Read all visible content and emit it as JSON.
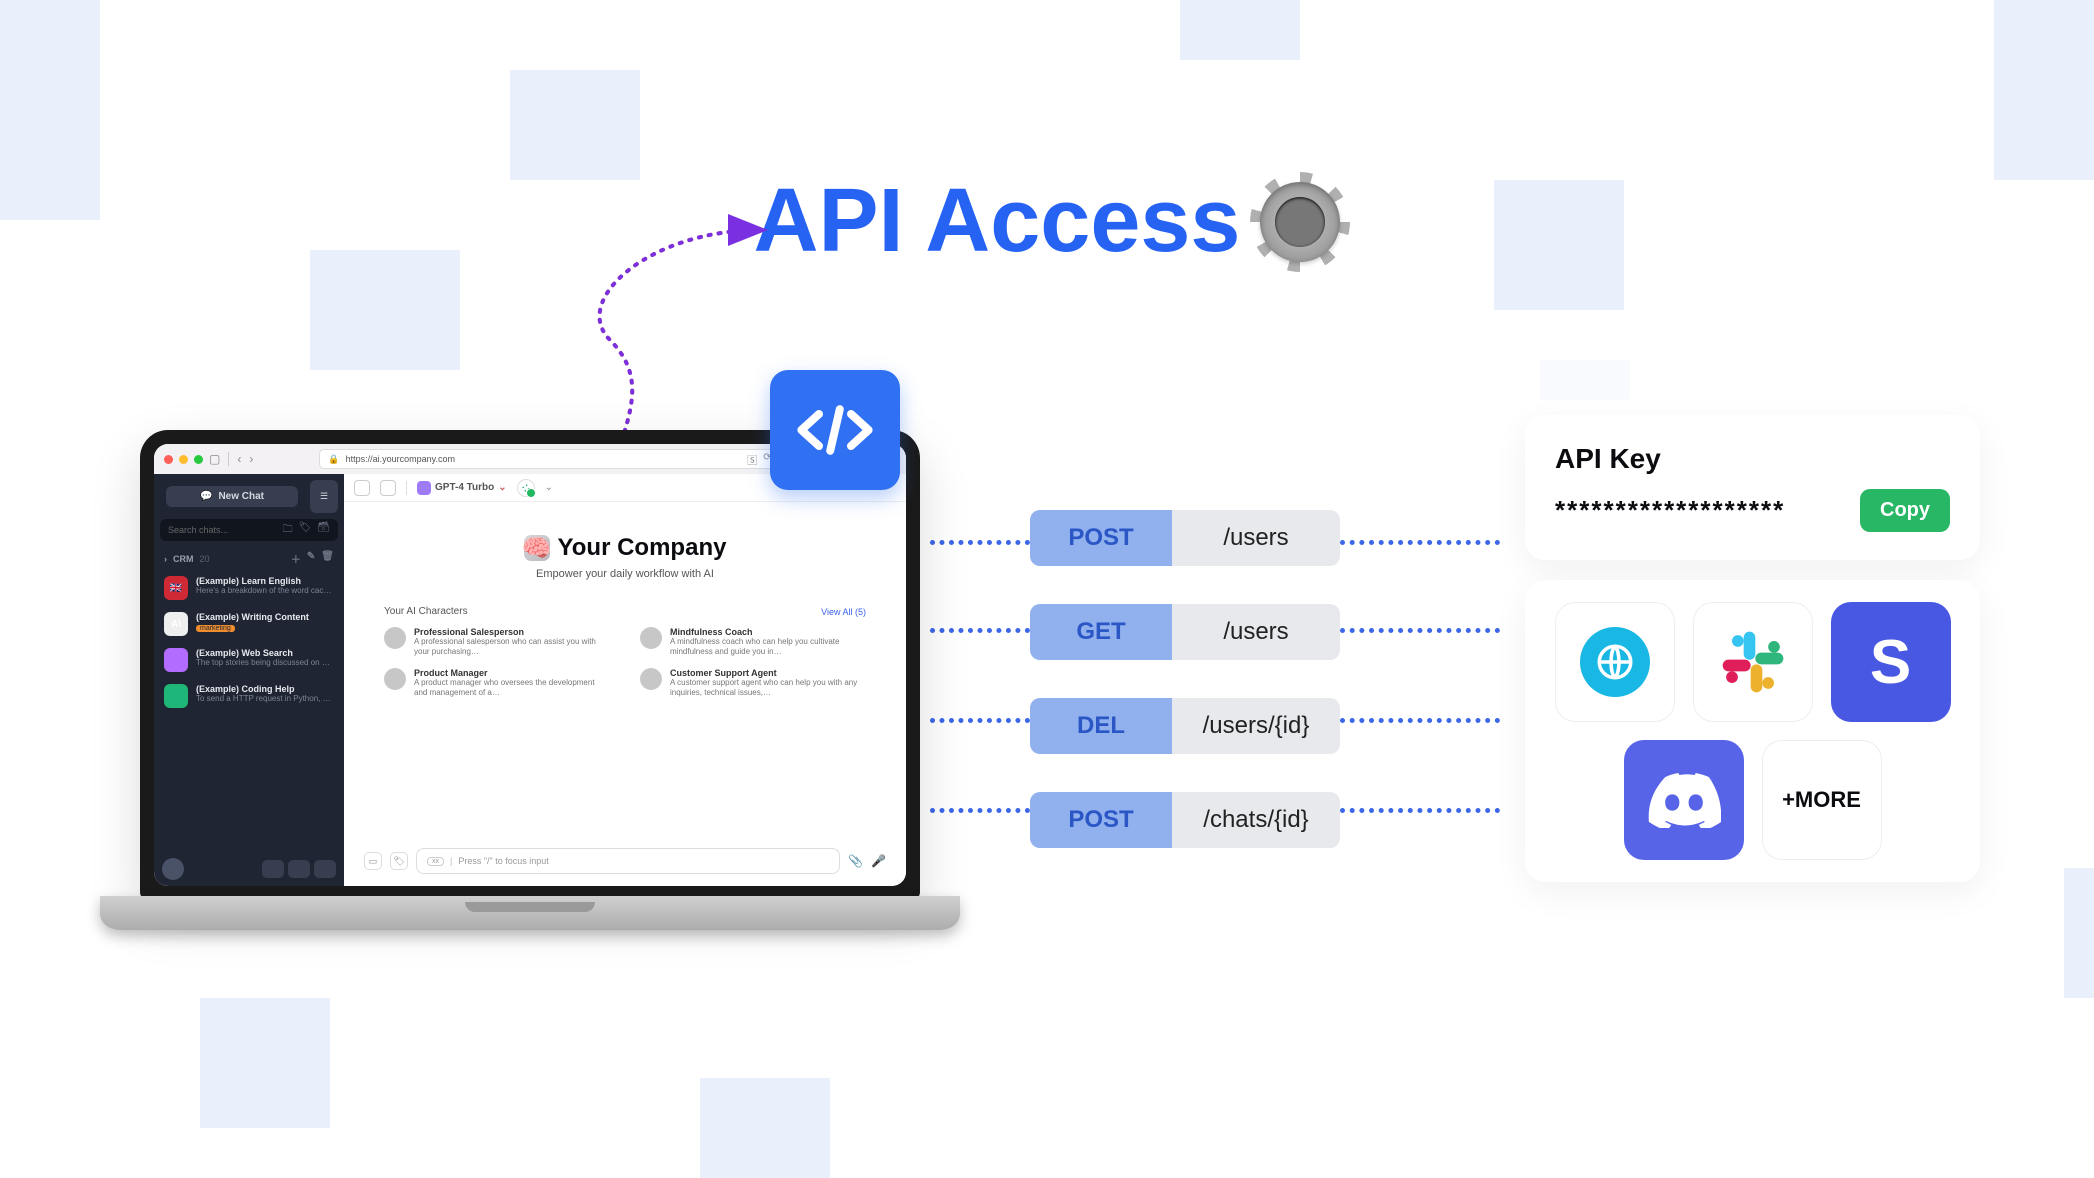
{
  "headline": "API Access",
  "browser": {
    "url": "https://ai.yourcompany.com"
  },
  "sidebar": {
    "new_chat": "New Chat",
    "search_placeholder": "Search chats...",
    "folder": {
      "name": "CRM",
      "count": "20"
    },
    "chats": [
      {
        "title": "(Example) Learn English",
        "sub": "Here's a breakdown of the word cac…",
        "thumb_bg": "#cf2a34",
        "thumb_text": "🇬🇧"
      },
      {
        "title": "(Example) Writing Content",
        "sub": "",
        "tag": "marketing",
        "thumb_bg": "#efefef",
        "thumb_text": "A\\"
      },
      {
        "title": "(Example) Web Search",
        "sub": "The top stories being discussed on H…",
        "thumb_bg": "#b26cff",
        "thumb_text": ""
      },
      {
        "title": "(Example) Coding Help",
        "sub": "To send a HTTP request in Python, y…",
        "thumb_bg": "#1fb779",
        "thumb_text": ""
      }
    ]
  },
  "topbar": {
    "model": "GPT-4 Turbo"
  },
  "hero": {
    "title": "Your Company",
    "subtitle": "Empower your daily workflow with AI"
  },
  "characters": {
    "heading": "Your AI Characters",
    "view_all": "View All (5)",
    "items": [
      {
        "name": "Professional Salesperson",
        "desc": "A professional salesperson who can assist you with your purchasing…"
      },
      {
        "name": "Mindfulness Coach",
        "desc": "A mindfulness coach who can help you cultivate mindfulness and guide you in…"
      },
      {
        "name": "Product Manager",
        "desc": "A product manager who oversees the development and management of a…"
      },
      {
        "name": "Customer Support Agent",
        "desc": "A customer support agent who can help you with any inquiries, technical issues,…"
      }
    ]
  },
  "compose": {
    "voice": "xx",
    "placeholder": "Press \"/\" to focus input"
  },
  "endpoints": [
    {
      "method": "POST",
      "path": "/users"
    },
    {
      "method": "GET",
      "path": "/users"
    },
    {
      "method": "DEL",
      "path": "/users/{id}"
    },
    {
      "method": "POST",
      "path": "/chats/{id}"
    }
  ],
  "apikey": {
    "label": "API Key",
    "value": "*******************",
    "copy": "Copy"
  },
  "integrations": {
    "more": "+MORE"
  }
}
